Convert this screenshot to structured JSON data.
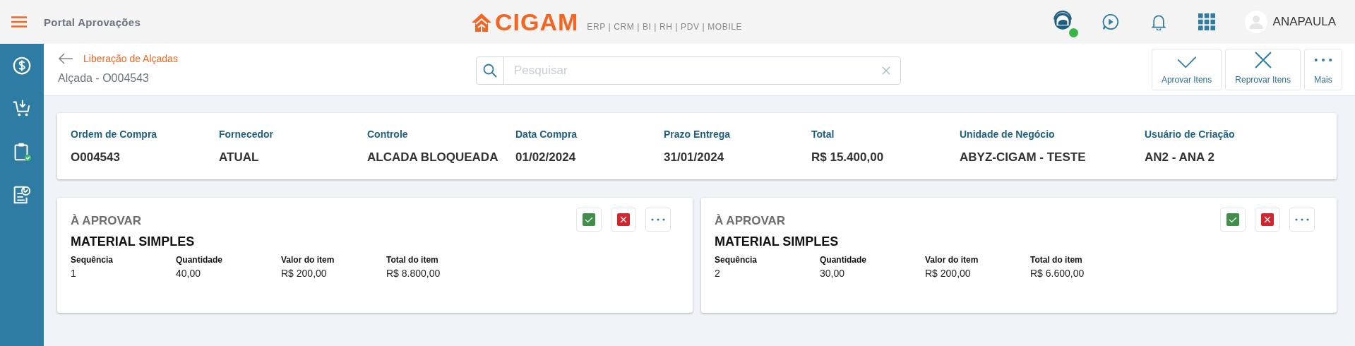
{
  "topbar": {
    "app_title": "Portal Aprovações",
    "logo": "CIGAM",
    "logo_tagline": "ERP | CRM | BI | RH | PDV | MOBILE",
    "support_online": true,
    "user": "ANAPAULA"
  },
  "sidebar": {
    "items": [
      {
        "kind": "money"
      },
      {
        "kind": "cart"
      },
      {
        "kind": "clipboard"
      },
      {
        "kind": "checklist"
      }
    ]
  },
  "header": {
    "back_link": "Liberação de Alçadas",
    "title": "Alçada - O004543",
    "search": {
      "placeholder": "Pesquisar"
    },
    "actions": [
      {
        "kind": "check",
        "label": "Aprovar Itens"
      },
      {
        "kind": "close",
        "label": "Reprovar Itens"
      },
      {
        "kind": "dots",
        "label": "Mais"
      }
    ]
  },
  "summary": {
    "fields": [
      {
        "label": "Ordem de Compra",
        "value": "O004543"
      },
      {
        "label": "Fornecedor",
        "value": "ATUAL"
      },
      {
        "label": "Controle",
        "value": "ALCADA BLOQUEADA"
      },
      {
        "label": "Data Compra",
        "value": "01/02/2024"
      },
      {
        "label": "Prazo Entrega",
        "value": "31/01/2024"
      },
      {
        "label": "Total",
        "value": "R$ 15.400,00"
      },
      {
        "label": "Unidade de Negócio",
        "value": "ABYZ-CIGAM - TESTE"
      },
      {
        "label": "Usuário de Criação",
        "value": "AN2 - ANA 2"
      }
    ]
  },
  "items": [
    {
      "status": "À APROVAR",
      "name": "MATERIAL SIMPLES",
      "fields": [
        {
          "label": "Sequência",
          "value": "1"
        },
        {
          "label": "Quantidade",
          "value": "40,00"
        },
        {
          "label": "Valor do item",
          "value": "R$ 200,00"
        },
        {
          "label": "Total do item",
          "value": "R$ 8.800,00"
        }
      ]
    },
    {
      "status": "À APROVAR",
      "name": "MATERIAL SIMPLES",
      "fields": [
        {
          "label": "Sequência",
          "value": "2"
        },
        {
          "label": "Quantidade",
          "value": "30,00"
        },
        {
          "label": "Valor do item",
          "value": "R$ 200,00"
        },
        {
          "label": "Total do item",
          "value": "R$ 6.600,00"
        }
      ]
    }
  ]
}
